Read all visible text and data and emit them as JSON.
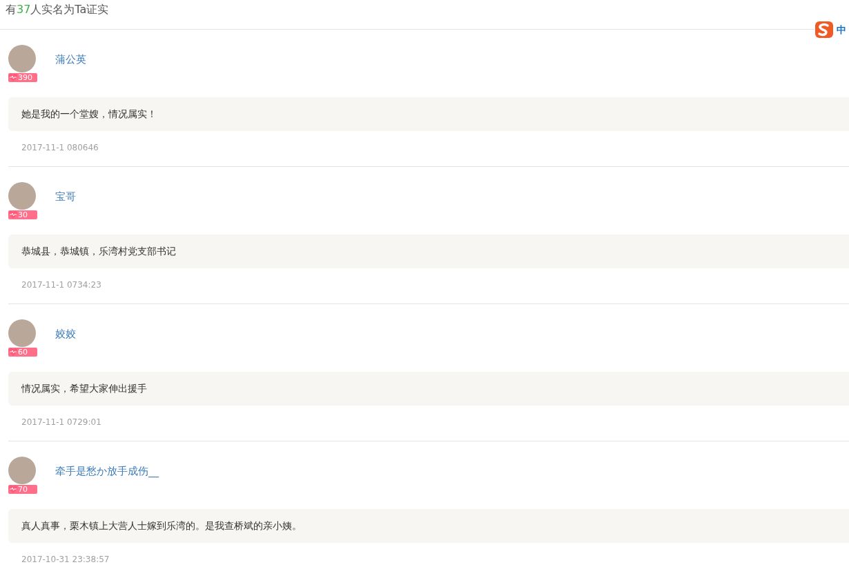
{
  "header": {
    "prefix": "有",
    "count": "37",
    "suffix": "人实名为Ta证实"
  },
  "ime": {
    "label": "中"
  },
  "comments": [
    {
      "name": "蒲公英",
      "score": "390",
      "text": "她是我的一个堂嫂，情况属实！",
      "time": "2017-11-1 080646"
    },
    {
      "name": "宝哥",
      "score": "30",
      "text": "恭城县，恭城镇，乐湾村党支部书记",
      "time": "2017-11-1 0734:23"
    },
    {
      "name": "姣姣",
      "score": "60",
      "text": "情况属实，希望大家伸出援手",
      "time": "2017-11-1 0729:01"
    },
    {
      "name": "牵手是愁か放手成伤__",
      "score": "70",
      "text": "真人真事，栗木镇上大营人士嫁到乐湾的。是我查桥斌的亲小姨。",
      "time": "2017-10-31 23:38:57"
    }
  ]
}
